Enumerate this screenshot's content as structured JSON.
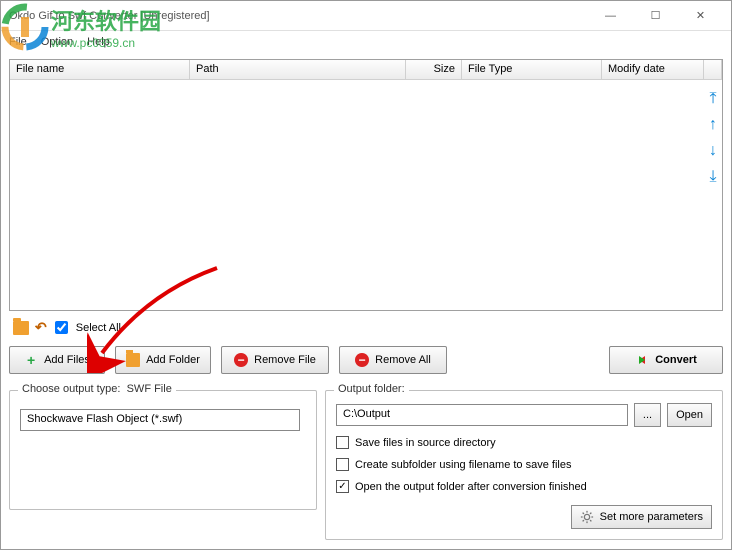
{
  "window": {
    "title": "Okdo Gif to Swf Converter [Unregistered]",
    "min": "—",
    "max": "☐",
    "close": "✕"
  },
  "menu": {
    "file": "File",
    "option": "Option",
    "help": "Help"
  },
  "watermark": {
    "cn": "河东软件园",
    "url": "www.pc0359.cn"
  },
  "table": {
    "cols": {
      "fname": "File name",
      "path": "Path",
      "size": "Size",
      "type": "File Type",
      "date": "Modify date"
    }
  },
  "selectAll": "Select All",
  "buttons": {
    "addFiles": "Add Files",
    "addFolder": "Add Folder",
    "removeFile": "Remove File",
    "removeAll": "Remove All",
    "convert": "Convert"
  },
  "outputType": {
    "label": "Choose output type:",
    "value": "SWF File",
    "format": "Shockwave Flash Object (*.swf)"
  },
  "outputFolder": {
    "label": "Output folder:",
    "path": "C:\\Output",
    "browse": "...",
    "open": "Open"
  },
  "checks": {
    "saveSrc": "Save files in source directory",
    "createSub": "Create subfolder using filename to save files",
    "openAfter": "Open the output folder after conversion finished"
  },
  "moreParams": "Set more parameters",
  "selectAllChecked": true,
  "openAfterChecked": true
}
